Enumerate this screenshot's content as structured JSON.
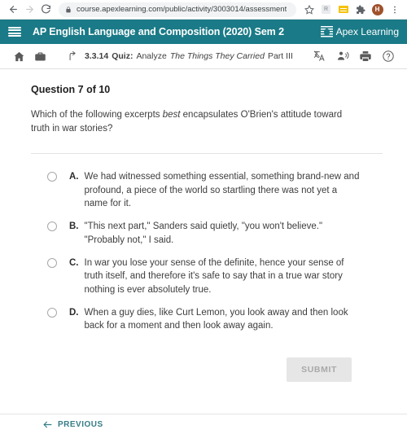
{
  "browser": {
    "back_label": "back-arrow",
    "forward_label": "forward-arrow",
    "reload_label": "reload",
    "url": "course.apexlearning.com/public/activity/3003014/assessment",
    "bookmark_label": "star-icon",
    "extension_1_label": "R",
    "profile_initial": "H",
    "menu_label": "kebab-menu"
  },
  "header": {
    "menu_label": "hamburger-menu",
    "course_title": "AP English Language and Composition (2020) Sem 2",
    "brand_name": "Apex Learning"
  },
  "toolbar": {
    "home_label": "home-icon",
    "briefcase_label": "briefcase-icon",
    "up_label": "move-up-icon",
    "breadcrumb": {
      "number": "3.3.14",
      "type": "Quiz:",
      "verb": "Analyze",
      "title_italic": "The Things They Carried",
      "part": "Part III"
    },
    "translate_label": "translate-icon",
    "read_aloud_label": "read-aloud-icon",
    "print_label": "print-icon",
    "help_label": "help-icon"
  },
  "question": {
    "number_label": "Question 7 of 10",
    "prompt_before": "Which of the following excerpts ",
    "prompt_emphasis": "best",
    "prompt_after": " encapsulates O'Brien's attitude toward truth in war stories?",
    "options": [
      {
        "letter": "A.",
        "text": "We had witnessed something essential, something brand-new and profound, a piece of the world so startling there was not yet a name for it.",
        "selected": false
      },
      {
        "letter": "B.",
        "text": "\"This next part,\" Sanders said quietly, \"you won't believe.\" \"Probably not,\" I said.",
        "selected": false
      },
      {
        "letter": "C.",
        "text": "In war you lose your sense of the definite, hence your sense of truth itself, and therefore it's safe to say that in a true war story nothing is ever absolutely true.",
        "selected": false
      },
      {
        "letter": "D.",
        "text": "When a guy dies, like Curt Lemon, you look away and then look back for a moment and then look away again.",
        "selected": false
      }
    ]
  },
  "actions": {
    "submit_label": "SUBMIT",
    "submit_enabled": false,
    "previous_label": "PREVIOUS"
  },
  "colors": {
    "brand_teal": "#1a7a87",
    "link_teal": "#367c86",
    "text_primary": "#3d3d3d",
    "submit_disabled_bg": "#e6e6e6"
  }
}
